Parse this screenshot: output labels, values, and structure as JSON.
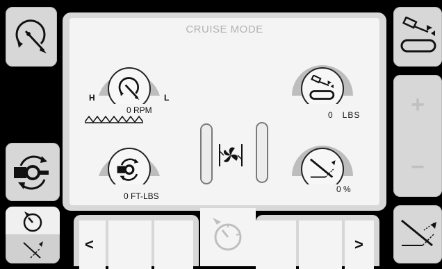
{
  "header": {
    "mode_title": "CRUISE MODE"
  },
  "gauges": {
    "rpm": {
      "value_text": "0 RPM",
      "high_label": "H",
      "low_label": "L",
      "icon": "rotation-tool-icon"
    },
    "load": {
      "value_text": "0   LBS",
      "icon": "conveyor-sensor-icon"
    },
    "torque": {
      "value_text": "0 FT-LBS",
      "icon": "torque-joint-icon"
    },
    "percent": {
      "value_text": "0 %",
      "icon": "blade-speed-icon"
    }
  },
  "center": {
    "icon": "fan-coupling-icon"
  },
  "navigation": {
    "prev_label": "<",
    "next_label": ">",
    "speedometer_icon": "speedometer-icon"
  },
  "side_right": {
    "plus_label": "+",
    "minus_label": "−"
  },
  "colors": {
    "background": "#000000",
    "panel": "#d8d8d8",
    "panel_inner": "#f4f4f4",
    "dial": "#bdbdbd",
    "text": "#111111"
  }
}
